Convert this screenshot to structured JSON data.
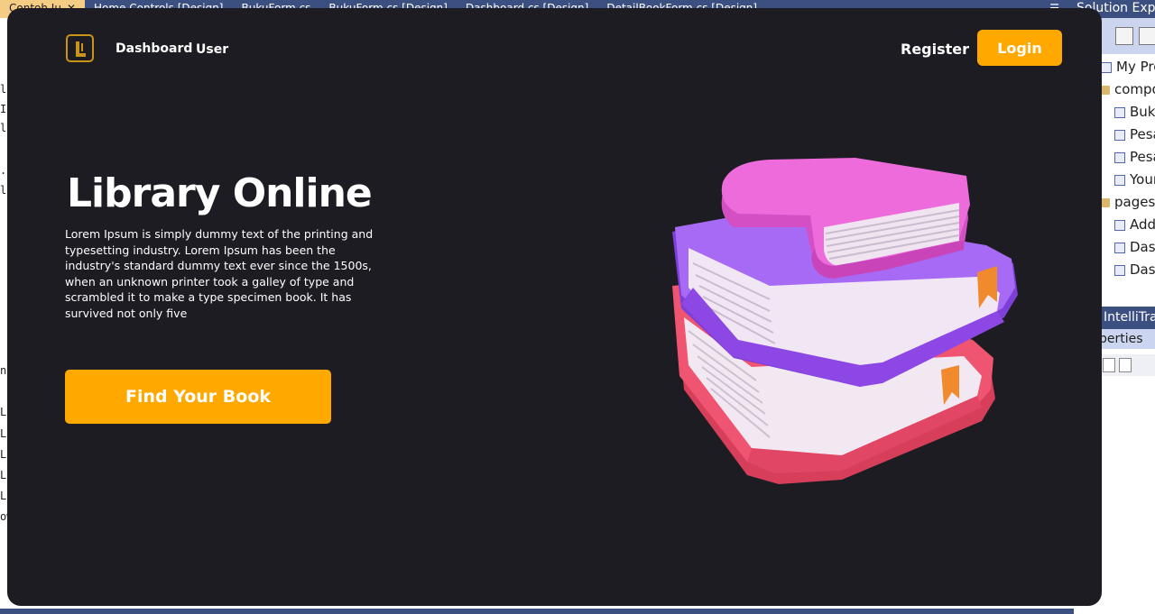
{
  "ide": {
    "tabs": [
      {
        "label": "Contoh.Ju",
        "active": true
      },
      {
        "label": "Home.Controls.[Design]"
      },
      {
        "label": "BukuForm.cs"
      },
      {
        "label": "BukuForm.cs [Design]"
      },
      {
        "label": "Dashboard.cs [Design]"
      },
      {
        "label": "DetailBookForm.cs [Design]"
      }
    ],
    "gutter": [
      "le",
      "ID",
      "la",
      ".I",
      "l",
      "n",
      "LE",
      "LE",
      "LE",
      "LE",
      "LE",
      "ow"
    ],
    "solution_explorer": {
      "title": "Solution Exp",
      "tree": [
        {
          "label": "My Pro",
          "icon": "file",
          "indent": 0
        },
        {
          "label": "compo",
          "icon": "folder",
          "indent": 0
        },
        {
          "label": "Buku",
          "icon": "file",
          "indent": 1
        },
        {
          "label": "Pesa",
          "icon": "file",
          "indent": 1
        },
        {
          "label": "Pesa",
          "icon": "file",
          "indent": 1
        },
        {
          "label": "Your",
          "icon": "file",
          "indent": 1
        },
        {
          "label": "pages",
          "icon": "folder",
          "indent": 0
        },
        {
          "label": "Add",
          "icon": "file",
          "indent": 1
        },
        {
          "label": "Dash",
          "icon": "file",
          "indent": 1
        },
        {
          "label": "Dash",
          "icon": "file",
          "indent": 1
        }
      ],
      "intellitrace": "IntelliTra",
      "properties": "perties"
    }
  },
  "app": {
    "nav": {
      "dashboard": "Dashboard",
      "user": "User",
      "register": "Register",
      "login": "Login"
    },
    "hero": {
      "title": "Library Online",
      "description": "Lorem Ipsum is simply dummy text of the printing and typesetting industry. Lorem Ipsum has been the industry's standard dummy text ever since the 1500s, when an unknown printer took a galley of type and scrambled it to make a type specimen book. It has survived not only five",
      "cta": "Find Your Book"
    },
    "colors": {
      "background": "#1c1c22",
      "accent": "#ffa800",
      "text": "#ffffff",
      "logo": "#c99418",
      "book_top": "#e55bd2",
      "book_middle": "#9b5cf0",
      "book_bottom": "#ec4d6a"
    },
    "icons": {
      "logo": "library-logo-icon",
      "illustration": "stacked-books-illustration"
    }
  }
}
